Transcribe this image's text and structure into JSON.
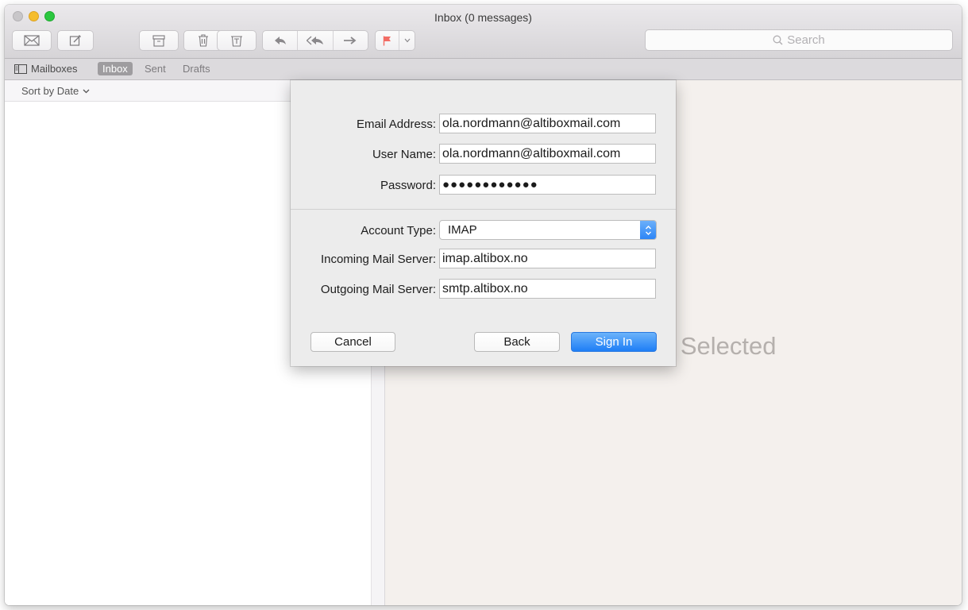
{
  "window": {
    "title": "Inbox (0 messages)"
  },
  "toolbar": {
    "search_placeholder": "Search"
  },
  "favorites": {
    "mailboxes_label": "Mailboxes",
    "inbox_label": "Inbox",
    "sent_label": "Sent",
    "drafts_label": "Drafts"
  },
  "list": {
    "sort_label": "Sort by Date"
  },
  "message_pane": {
    "empty_text": "e Selected"
  },
  "account_sheet": {
    "email_label": "Email Address:",
    "email_value": "ola.nordmann@altiboxmail.com",
    "username_label": "User Name:",
    "username_value": "ola.nordmann@altiboxmail.com",
    "password_label": "Password:",
    "password_value": "●●●●●●●●●●●●",
    "account_type_label": "Account Type:",
    "account_type_value": "IMAP",
    "incoming_label": "Incoming Mail Server:",
    "incoming_value": "imap.altibox.no",
    "outgoing_label": "Outgoing Mail Server:",
    "outgoing_value": "smtp.altibox.no",
    "cancel_label": "Cancel",
    "back_label": "Back",
    "signin_label": "Sign In"
  },
  "colors": {
    "accent": "#2a84f6",
    "flag": "#f26c64",
    "traffic_min": "#f5bd2d",
    "traffic_max": "#2bc73f"
  },
  "icons": [
    "envelope-icon",
    "compose-icon",
    "archive-icon",
    "trash-icon",
    "junk-icon",
    "reply-icon",
    "reply-all-icon",
    "forward-icon",
    "flag-icon",
    "chevron-down-icon",
    "search-icon",
    "sidebar-icon",
    "stepper-icon"
  ]
}
